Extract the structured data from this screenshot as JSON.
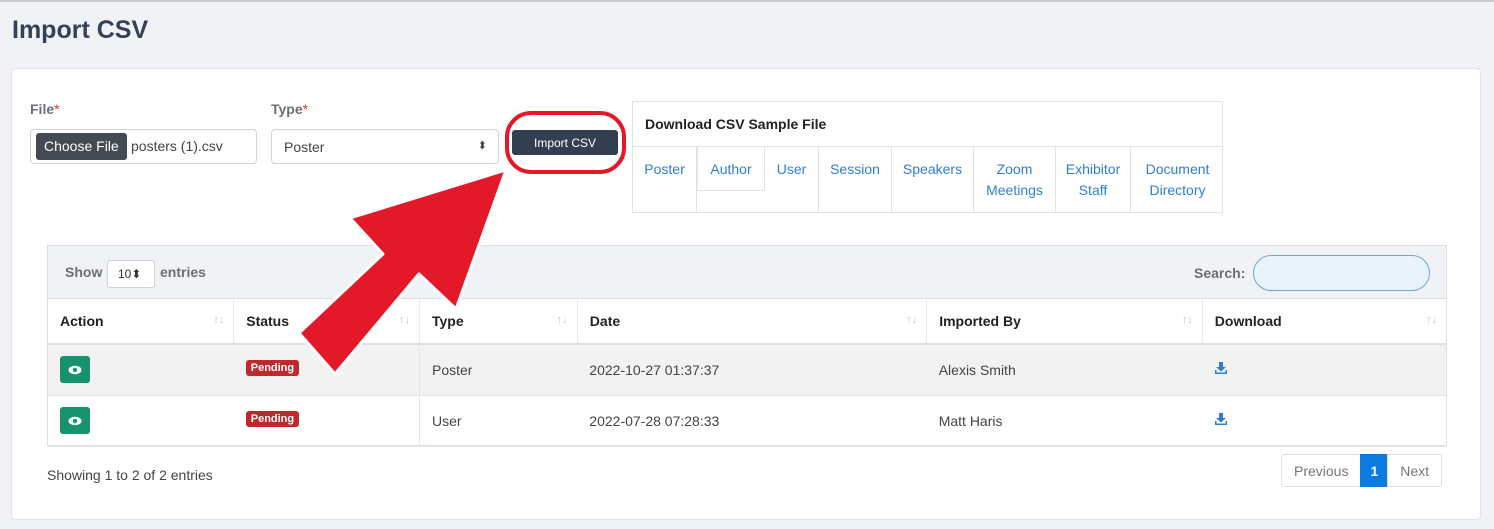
{
  "page": {
    "title": "Import CSV"
  },
  "form": {
    "file_label": "File",
    "type_label": "Type",
    "required_mark": "*",
    "choose_file_label": "Choose File",
    "file_name": "posters (1).csv",
    "type_value": "Poster",
    "select_arrow": "⬍",
    "import_label": "Import CSV"
  },
  "samples": {
    "title": "Download CSV Sample File",
    "links": [
      {
        "line1": "Poster",
        "line2": ""
      },
      {
        "line1": "Author",
        "line2": ""
      },
      {
        "line1": "User",
        "line2": ""
      },
      {
        "line1": "Session",
        "line2": ""
      },
      {
        "line1": "Speakers",
        "line2": ""
      },
      {
        "line1": "Zoom",
        "line2": "Meetings"
      },
      {
        "line1": "Exhibitor",
        "line2": "Staff"
      },
      {
        "line1": "Document",
        "line2": "Directory"
      }
    ]
  },
  "table": {
    "show_label": "Show",
    "page_length": "10",
    "entries_label": "entries",
    "search_label": "Search:",
    "search_value": "",
    "sort_glyph": "↑↓",
    "columns": [
      "Action",
      "Status",
      "Type",
      "Date",
      "Imported By",
      "Download"
    ],
    "rows": [
      {
        "status": "Pending",
        "type": "Poster",
        "date": "2022-10-27 01:37:37",
        "imported_by": "Alexis Smith"
      },
      {
        "status": "Pending",
        "type": "User",
        "date": "2022-07-28 07:28:33",
        "imported_by": "Matt Haris"
      }
    ],
    "info": "Showing 1 to 2 of 2 entries"
  },
  "pagination": {
    "previous": "Previous",
    "current": "1",
    "next": "Next"
  },
  "colors": {
    "primary_dark": "#333f50",
    "success": "#16926d",
    "danger_badge": "#c0282e",
    "link": "#2f7fd0",
    "annotation_red": "#e3192a",
    "pager_active": "#0b7be0"
  },
  "icons": {
    "view": "eye-icon",
    "download": "download-icon",
    "annotation": "arrow-annotation"
  }
}
